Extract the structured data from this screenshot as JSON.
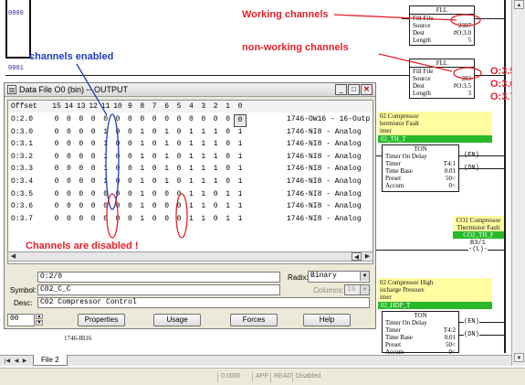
{
  "ladder": {
    "rung_numbers": [
      "0000",
      "0001"
    ],
    "fll_top": {
      "header": "FLL",
      "title": "Fill File",
      "rows": [
        {
          "label": "Source",
          "value": "2397"
        },
        {
          "label": "Dest",
          "value": "#O:3.0"
        },
        {
          "label": "Length",
          "value": "5"
        }
      ]
    },
    "fll_bottom": {
      "header": "FLL",
      "title": "Fill File",
      "rows": [
        {
          "label": "Source",
          "value": "283"
        },
        {
          "label": "Dest",
          "value": "#O:3.5"
        },
        {
          "label": "Length",
          "value": "3"
        }
      ]
    },
    "comment1": {
      "lines": [
        "02 Compressor",
        "hermistor Fault",
        "imer"
      ]
    },
    "tag1": "02_TH_T",
    "ton1": {
      "header": "TON",
      "title": "Timer On Delay",
      "rows": [
        {
          "label": "Timer",
          "value": "T4:1"
        },
        {
          "label": "Time Base",
          "value": "0.01"
        },
        {
          "label": "Preset",
          "value": "50<"
        },
        {
          "label": "Accum",
          "value": "0<"
        }
      ]
    },
    "comment2": {
      "lines": [
        "CO2 Compressor",
        "Thermistor Fault"
      ]
    },
    "tag2": "CO2_TH_F",
    "latch_addr": "B3/1",
    "comment3": {
      "lines": [
        "02 Compressor High",
        "ischarge Pressure",
        "imer"
      ]
    },
    "tag3": "02_HDP_T",
    "ton2": {
      "header": "TON",
      "title": "Timer On Delay",
      "rows": [
        {
          "label": "Timer",
          "value": "T4:2"
        },
        {
          "label": "Time Base",
          "value": "0.01"
        },
        {
          "label": "Preset",
          "value": "50<"
        },
        {
          "label": "Accum",
          "value": "0<"
        }
      ]
    },
    "coil_en": "EN",
    "coil_dn": "DN",
    "coil_l": "L",
    "module_label": "1746-IB16"
  },
  "annotations": {
    "working": "Working channels",
    "non_working": "non-working channels",
    "channels_enabled": "channels enabled",
    "channels_disabled": "Channels are disabled !",
    "outputs": [
      "O:3.5",
      "O:3.6",
      "O:3.7"
    ]
  },
  "datafile": {
    "title": "Data File O0 (bin) -- OUTPUT",
    "header_offset": "Offset",
    "header_bits": [
      "15",
      "14",
      "13",
      "12",
      "11",
      "10",
      "9",
      "8",
      "7",
      "6",
      "5",
      "4",
      "3",
      "2",
      "1",
      "0"
    ],
    "rows": [
      {
        "offset": "O:2.0",
        "bits": [
          "0",
          "0",
          "0",
          "0",
          "0",
          "0",
          "0",
          "0",
          "0",
          "0",
          "0",
          "0",
          "0",
          "0",
          "0",
          "0"
        ],
        "desc": "1746-OW16 - 16-Outp"
      },
      {
        "offset": "O:3.0",
        "bits": [
          "0",
          "0",
          "0",
          "0",
          "1",
          "0",
          "0",
          "1",
          "0",
          "1",
          "0",
          "1",
          "1",
          "1",
          "0",
          "1"
        ],
        "desc": "1746-NI8 - Analog"
      },
      {
        "offset": "O:3.1",
        "bits": [
          "0",
          "0",
          "0",
          "0",
          "1",
          "0",
          "0",
          "1",
          "0",
          "1",
          "0",
          "1",
          "1",
          "1",
          "0",
          "1"
        ],
        "desc": "1746-NI8 - Analog"
      },
      {
        "offset": "O:3.2",
        "bits": [
          "0",
          "0",
          "0",
          "0",
          "1",
          "0",
          "0",
          "1",
          "0",
          "1",
          "0",
          "1",
          "1",
          "1",
          "0",
          "1"
        ],
        "desc": "1746-NI8 - Analog"
      },
      {
        "offset": "O:3.3",
        "bits": [
          "0",
          "0",
          "0",
          "0",
          "1",
          "0",
          "0",
          "1",
          "0",
          "1",
          "0",
          "1",
          "1",
          "1",
          "0",
          "1"
        ],
        "desc": "1746-NI8 - Analog"
      },
      {
        "offset": "O:3.4",
        "bits": [
          "0",
          "0",
          "0",
          "0",
          "1",
          "0",
          "0",
          "1",
          "0",
          "1",
          "0",
          "1",
          "1",
          "1",
          "0",
          "1"
        ],
        "desc": "1746-NI8 - Analog"
      },
      {
        "offset": "O:3.5",
        "bits": [
          "0",
          "0",
          "0",
          "0",
          "0",
          "0",
          "0",
          "1",
          "0",
          "0",
          "0",
          "1",
          "1",
          "0",
          "1",
          "1"
        ],
        "desc": "1746-NI8 - Analog"
      },
      {
        "offset": "O:3.6",
        "bits": [
          "0",
          "0",
          "0",
          "0",
          "0",
          "0",
          "0",
          "1",
          "0",
          "0",
          "0",
          "1",
          "1",
          "0",
          "1",
          "1"
        ],
        "desc": "1746-NI8 - Analog"
      },
      {
        "offset": "O:3.7",
        "bits": [
          "0",
          "0",
          "0",
          "0",
          "0",
          "0",
          "0",
          "1",
          "0",
          "0",
          "0",
          "1",
          "1",
          "0",
          "1",
          "1"
        ],
        "desc": "1746-NI8 - Analog"
      }
    ],
    "address_value": "O:2/0",
    "radix_label": "Radix:",
    "radix_value": "Binary",
    "symbol_label": "Symbol:",
    "symbol_value": "C02_C_C",
    "columns_label": "Columns:",
    "columns_value": "16",
    "desc_label": "Desc:",
    "desc_value": "C02 Compressor Control",
    "file_number": "00",
    "buttons": {
      "properties": "Properties",
      "usage": "Usage",
      "forces": "Forces",
      "help": "Help"
    }
  },
  "bottom": {
    "sheet_tab": "File 2"
  },
  "statusbar": {
    "cells": [
      "0:0000",
      "APP",
      "READ",
      "Disabled"
    ]
  }
}
